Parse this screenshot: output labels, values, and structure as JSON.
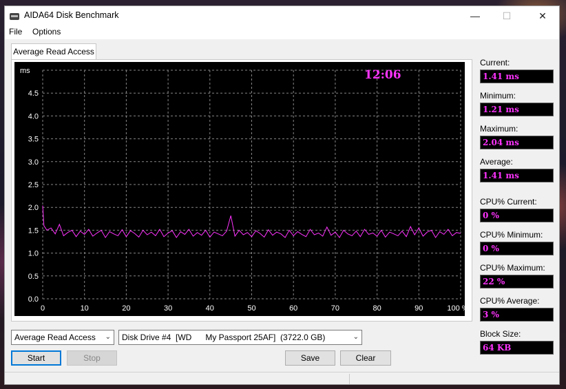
{
  "window": {
    "title": "AIDA64 Disk Benchmark",
    "min_glyph": "—",
    "max_glyph": "☐",
    "close_glyph": "✕"
  },
  "menu": [
    "File",
    "Options"
  ],
  "tab": {
    "label": "Average Read Access"
  },
  "chart_data": {
    "type": "line",
    "title": "",
    "ylabel": "ms",
    "xlabel": "",
    "ylim": [
      0,
      5
    ],
    "xlim": [
      0,
      100
    ],
    "y_ticks": [
      "4.5",
      "4.0",
      "3.5",
      "3.0",
      "2.5",
      "2.0",
      "1.5",
      "1.0",
      "0.5",
      "0.0"
    ],
    "x_ticks": [
      "0",
      "10",
      "20",
      "30",
      "40",
      "50",
      "60",
      "70",
      "80",
      "90",
      "100 %"
    ],
    "grid": true,
    "clock": "12:06",
    "series": [
      {
        "color": "#ff33ff",
        "x": [
          0,
          0.3,
          1,
          2,
          3,
          4,
          5,
          6,
          7,
          8,
          9,
          10,
          11,
          12,
          13,
          14,
          15,
          16,
          17,
          18,
          19,
          20,
          21,
          22,
          23,
          24,
          25,
          26,
          27,
          28,
          29,
          30,
          31,
          32,
          33,
          34,
          35,
          36,
          37,
          38,
          39,
          40,
          41,
          42,
          43,
          44,
          45,
          46,
          47,
          48,
          49,
          50,
          51,
          52,
          53,
          54,
          55,
          56,
          57,
          58,
          59,
          60,
          61,
          62,
          63,
          64,
          65,
          66,
          67,
          68,
          69,
          70,
          71,
          72,
          73,
          74,
          75,
          76,
          77,
          78,
          79,
          80,
          81,
          82,
          83,
          84,
          85,
          86,
          87,
          88,
          89,
          90,
          91,
          92,
          93,
          94,
          95,
          96,
          97,
          98,
          99,
          100
        ],
        "values": [
          2.04,
          1.6,
          1.5,
          1.55,
          1.42,
          1.63,
          1.38,
          1.45,
          1.5,
          1.36,
          1.48,
          1.41,
          1.52,
          1.37,
          1.44,
          1.5,
          1.34,
          1.47,
          1.42,
          1.38,
          1.51,
          1.36,
          1.49,
          1.43,
          1.35,
          1.5,
          1.4,
          1.46,
          1.38,
          1.52,
          1.36,
          1.44,
          1.49,
          1.34,
          1.47,
          1.41,
          1.52,
          1.37,
          1.45,
          1.39,
          1.5,
          1.35,
          1.46,
          1.42,
          1.38,
          1.48,
          1.82,
          1.37,
          1.5,
          1.4,
          1.45,
          1.36,
          1.49,
          1.43,
          1.35,
          1.51,
          1.39,
          1.46,
          1.42,
          1.34,
          1.5,
          1.38,
          1.47,
          1.41,
          1.36,
          1.52,
          1.4,
          1.44,
          1.37,
          1.57,
          1.39,
          1.46,
          1.34,
          1.5,
          1.42,
          1.38,
          1.48,
          1.36,
          1.52,
          1.41,
          1.44,
          1.37,
          1.5,
          1.35,
          1.46,
          1.42,
          1.38,
          1.48,
          1.36,
          1.58,
          1.4,
          1.55,
          1.37,
          1.46,
          1.5,
          1.34,
          1.47,
          1.41,
          1.52,
          1.38,
          1.45,
          1.43
        ]
      }
    ]
  },
  "stats": [
    {
      "label": "Current:",
      "value": "1.41 ms"
    },
    {
      "label": "Minimum:",
      "value": "1.21 ms"
    },
    {
      "label": "Maximum:",
      "value": "2.04 ms"
    },
    {
      "label": "Average:",
      "value": "1.41 ms"
    },
    {
      "label": "CPU% Current:",
      "value": "0 %"
    },
    {
      "label": "CPU% Minimum:",
      "value": "0 %"
    },
    {
      "label": "CPU% Maximum:",
      "value": "22 %"
    },
    {
      "label": "CPU% Average:",
      "value": "3 %"
    },
    {
      "label": "Block Size:",
      "value": "64 KB"
    }
  ],
  "controls": {
    "test_select": "Average Read Access",
    "drive_select": "Disk Drive #4  [WD      My Passport 25AF]  (3722.0 GB)",
    "start": "Start",
    "stop": "Stop",
    "save": "Save",
    "clear": "Clear"
  }
}
